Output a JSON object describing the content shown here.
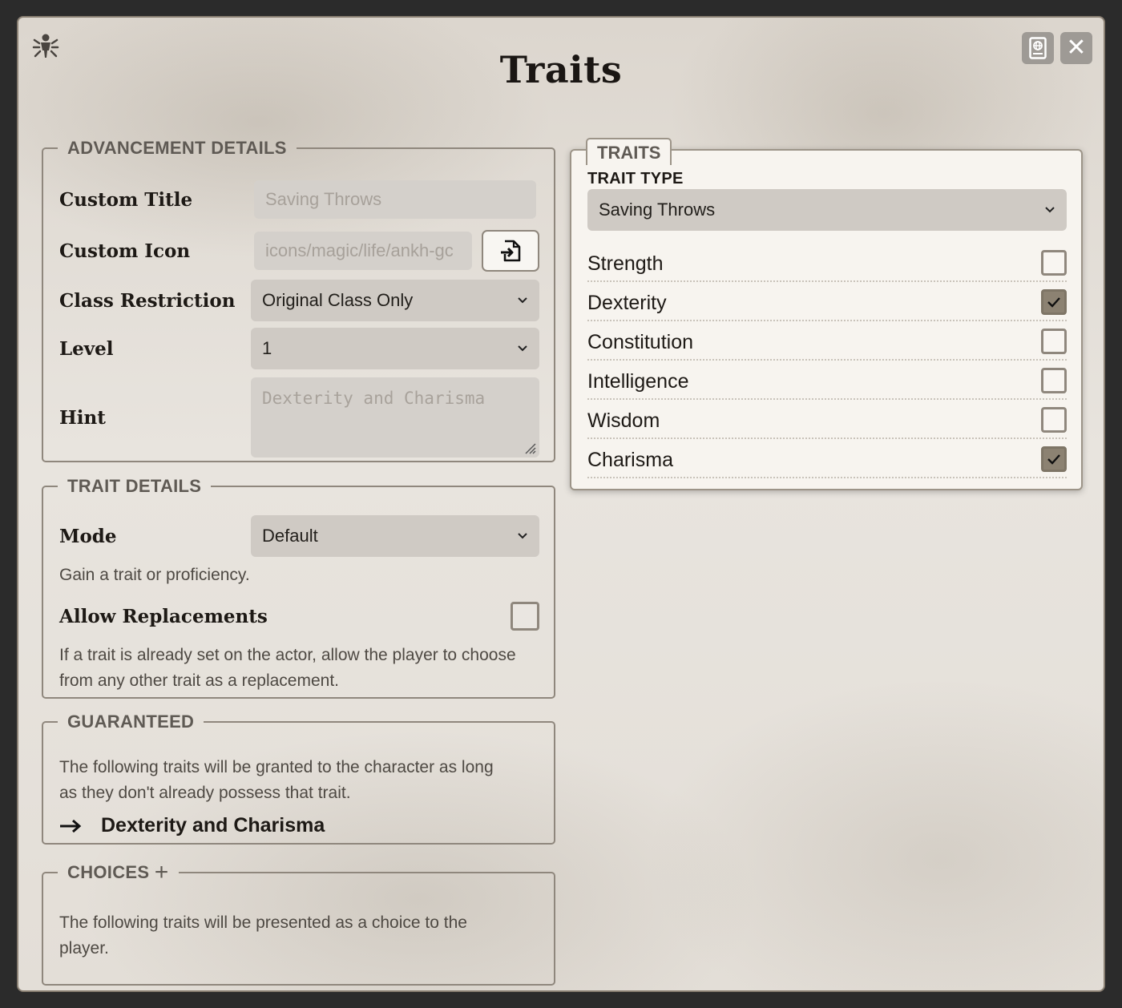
{
  "window": {
    "title": "Traits",
    "title_icon": "person-figure-icon",
    "buttons": [
      {
        "name": "book-icon"
      },
      {
        "name": "close-icon",
        "glyph": "✕"
      }
    ]
  },
  "advancement": {
    "legend": "ADVANCEMENT DETAILS",
    "custom_title_label": "Custom Title",
    "custom_title_placeholder": "Saving Throws",
    "custom_icon_label": "Custom Icon",
    "custom_icon_placeholder": "icons/magic/life/ankh-gc",
    "class_restriction_label": "Class Restriction",
    "class_restriction_value": "Original Class Only",
    "level_label": "Level",
    "level_value": "1",
    "hint_label": "Hint",
    "hint_placeholder": "Dexterity and Charisma"
  },
  "trait_details": {
    "legend": "TRAIT DETAILS",
    "mode_label": "Mode",
    "mode_value": "Default",
    "mode_description": "Gain a trait or proficiency.",
    "allow_replacements_label": "Allow Replacements",
    "allow_replacements_checked": false,
    "allow_replacements_desc_line1": "If a trait is already set on the actor, allow the player to choose",
    "allow_replacements_desc_line2": "from any other trait as a replacement."
  },
  "guaranteed": {
    "legend": "GUARANTEED",
    "desc_line1": "The following traits will be granted to the character as long",
    "desc_line2": "as they don't already possess that trait.",
    "value": "Dexterity and Charisma"
  },
  "choices": {
    "legend": "CHOICES",
    "add_glyph": "+",
    "desc_line1": "The following traits will be presented as a choice to the",
    "desc_line2": "player."
  },
  "traits": {
    "tab": "TRAITS",
    "type_label": "TRAIT TYPE",
    "type_value": "Saving Throws",
    "items": [
      {
        "label": "Strength",
        "checked": false
      },
      {
        "label": "Dexterity",
        "checked": true
      },
      {
        "label": "Constitution",
        "checked": false
      },
      {
        "label": "Intelligence",
        "checked": false
      },
      {
        "label": "Wisdom",
        "checked": false
      },
      {
        "label": "Charisma",
        "checked": true
      }
    ]
  },
  "colors": {
    "accent": "#8c8272",
    "border": "#8f877d",
    "field_bg": "#cfcac4"
  }
}
